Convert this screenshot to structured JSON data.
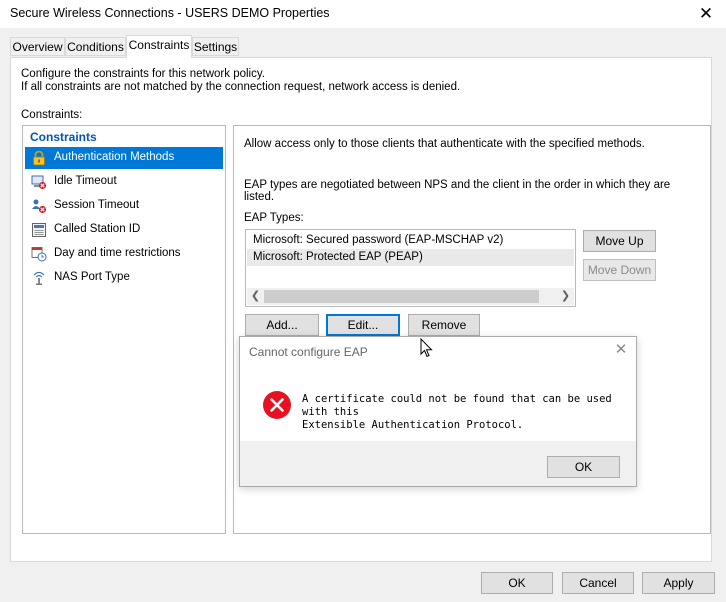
{
  "window": {
    "title": "Secure Wireless Connections - USERS DEMO Properties",
    "close_glyph": "✕"
  },
  "tabs": [
    {
      "label": "Overview"
    },
    {
      "label": "Conditions"
    },
    {
      "label": "Constraints",
      "active": true
    },
    {
      "label": "Settings"
    }
  ],
  "intro": {
    "line1": "Configure the constraints for this network policy.",
    "line2": "If all constraints are not matched by the connection request, network access is denied."
  },
  "constraints_label": "Constraints:",
  "tree": {
    "heading": "Constraints",
    "items": [
      {
        "label": "Authentication Methods",
        "icon": "lock-icon",
        "selected": true
      },
      {
        "label": "Idle Timeout",
        "icon": "idle-timeout-icon"
      },
      {
        "label": "Session Timeout",
        "icon": "session-timeout-icon"
      },
      {
        "label": "Called Station ID",
        "icon": "station-id-icon"
      },
      {
        "label": "Day and time restrictions",
        "icon": "calendar-clock-icon"
      },
      {
        "label": "NAS Port Type",
        "icon": "antenna-icon"
      }
    ]
  },
  "auth": {
    "description": "Allow access only to those clients that authenticate with the specified methods.",
    "eap_note_line1": "EAP types are negotiated between NPS and the client in the order in which they are",
    "eap_note_line2": "listed.",
    "eap_types_label": "EAP Types:",
    "eap_types": [
      {
        "label": "Microsoft: Secured password (EAP-MSCHAP v2)"
      },
      {
        "label": "Microsoft: Protected EAP (PEAP)",
        "selected": true
      }
    ],
    "buttons": {
      "move_up": "Move Up",
      "move_down": "Move Down",
      "add": "Add...",
      "edit": "Edit...",
      "remove": "Remove"
    }
  },
  "dialog": {
    "title": "Cannot configure EAP",
    "message_line1": "A certificate could not be found that can be used with this",
    "message_line2": "Extensible Authentication Protocol.",
    "ok": "OK",
    "close_glyph": "✕",
    "icon": "error-icon"
  },
  "footer": {
    "ok": "OK",
    "cancel": "Cancel",
    "apply": "Apply"
  },
  "colors": {
    "selection": "#0078d7",
    "heading_blue": "#0056b3",
    "error_red": "#e81123"
  }
}
